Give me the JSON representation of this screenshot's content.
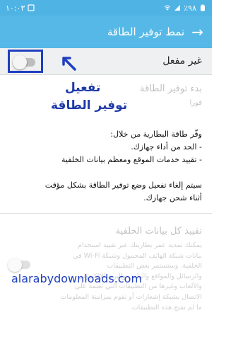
{
  "status_bar": {
    "time": "١٠:٠٣",
    "battery": "٪٩٨"
  },
  "app_bar": {
    "title": "نمط توفير الطاقة"
  },
  "master": {
    "label": "غير مفعل",
    "enabled": false
  },
  "power_saving": {
    "title": "بدء توفير الطاقة",
    "subtitle": "فورا"
  },
  "annotation": {
    "line1": "تفعيل",
    "line2": "توفير الطاقة"
  },
  "description": {
    "line1": "وفّر طاقة البطارية من خلال:",
    "line2": "- الحد من أداء جهازك.",
    "line3": "- تقييد خدمات الموقع ومعظم بيانات الخلفية",
    "line4": "سيتم إلغاء تفعيل وضع توفير الطاقة بشكل مؤقت",
    "line5": "أثناء شحن جهازك."
  },
  "background_data": {
    "title": "تقييد كل بيانات الخلفية",
    "lines": [
      "يمكنك تمديد عمر بطاريتك عبر تقييد استخدام",
      "بيانات شبكة الهاتف المحمول وشبكة Wi-Fi في",
      "الخلفية. وستستمر بعض التطبيقات",
      "والرسائل والمواقع والهاتف والبريد الإلكتروني",
      "والألعاب وغيرها من التطبيقات التي تعتمد على",
      "الاتصال بشبكة إشعارات أو تقوم بمزامنة المعلومات",
      "ما لم تفتح هذه التطبيقات."
    ],
    "enabled": false
  },
  "watermark": "alarabydownloads.com",
  "colors": {
    "status_bar": "#4fb3e3",
    "app_bar": "#56b8e6",
    "annotation": "#1e3aa8"
  }
}
